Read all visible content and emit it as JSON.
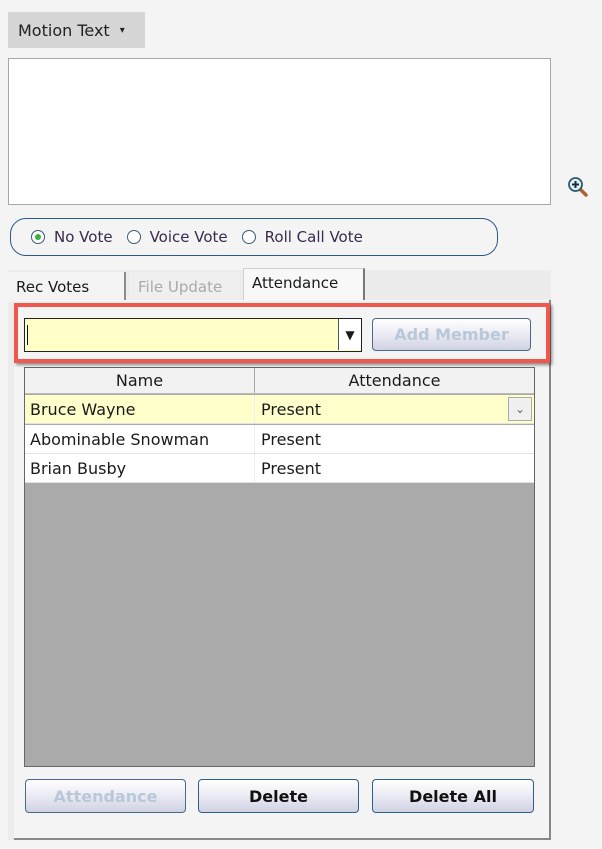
{
  "motion_text_menu": {
    "label": "Motion Text",
    "caret": "▾"
  },
  "motion_text_area": {
    "value": ""
  },
  "zoom_icon": "magnify-plus-icon",
  "vote_options": [
    {
      "label": "No Vote",
      "selected": true
    },
    {
      "label": "Voice Vote",
      "selected": false
    },
    {
      "label": "Roll Call Vote",
      "selected": false
    }
  ],
  "tabs": [
    {
      "label": "Rec Votes",
      "state": "normal"
    },
    {
      "label": "File Update",
      "state": "disabled"
    },
    {
      "label": "Attendance",
      "state": "active"
    }
  ],
  "member_combo": {
    "value": "",
    "dropdown_glyph": "▼"
  },
  "add_member_button": {
    "label": "Add Member",
    "enabled": false
  },
  "grid": {
    "columns": [
      "Name",
      "Attendance"
    ],
    "rows": [
      {
        "name": "Bruce Wayne",
        "attendance": "Present",
        "selected": true
      },
      {
        "name": "Abominable Snowman",
        "attendance": "Present",
        "selected": false
      },
      {
        "name": "Brian Busby",
        "attendance": "Present",
        "selected": false
      }
    ],
    "cell_dropdown_glyph": "⌄"
  },
  "footer_buttons": [
    {
      "label": "Attendance",
      "enabled": false
    },
    {
      "label": "Delete",
      "enabled": true
    },
    {
      "label": "Delete All",
      "enabled": true
    }
  ],
  "colors": {
    "highlight": "#f0584d",
    "selected_row": "#ffffcc",
    "combo_bg": "#ffffc8",
    "radio_dot": "#3cb043"
  }
}
